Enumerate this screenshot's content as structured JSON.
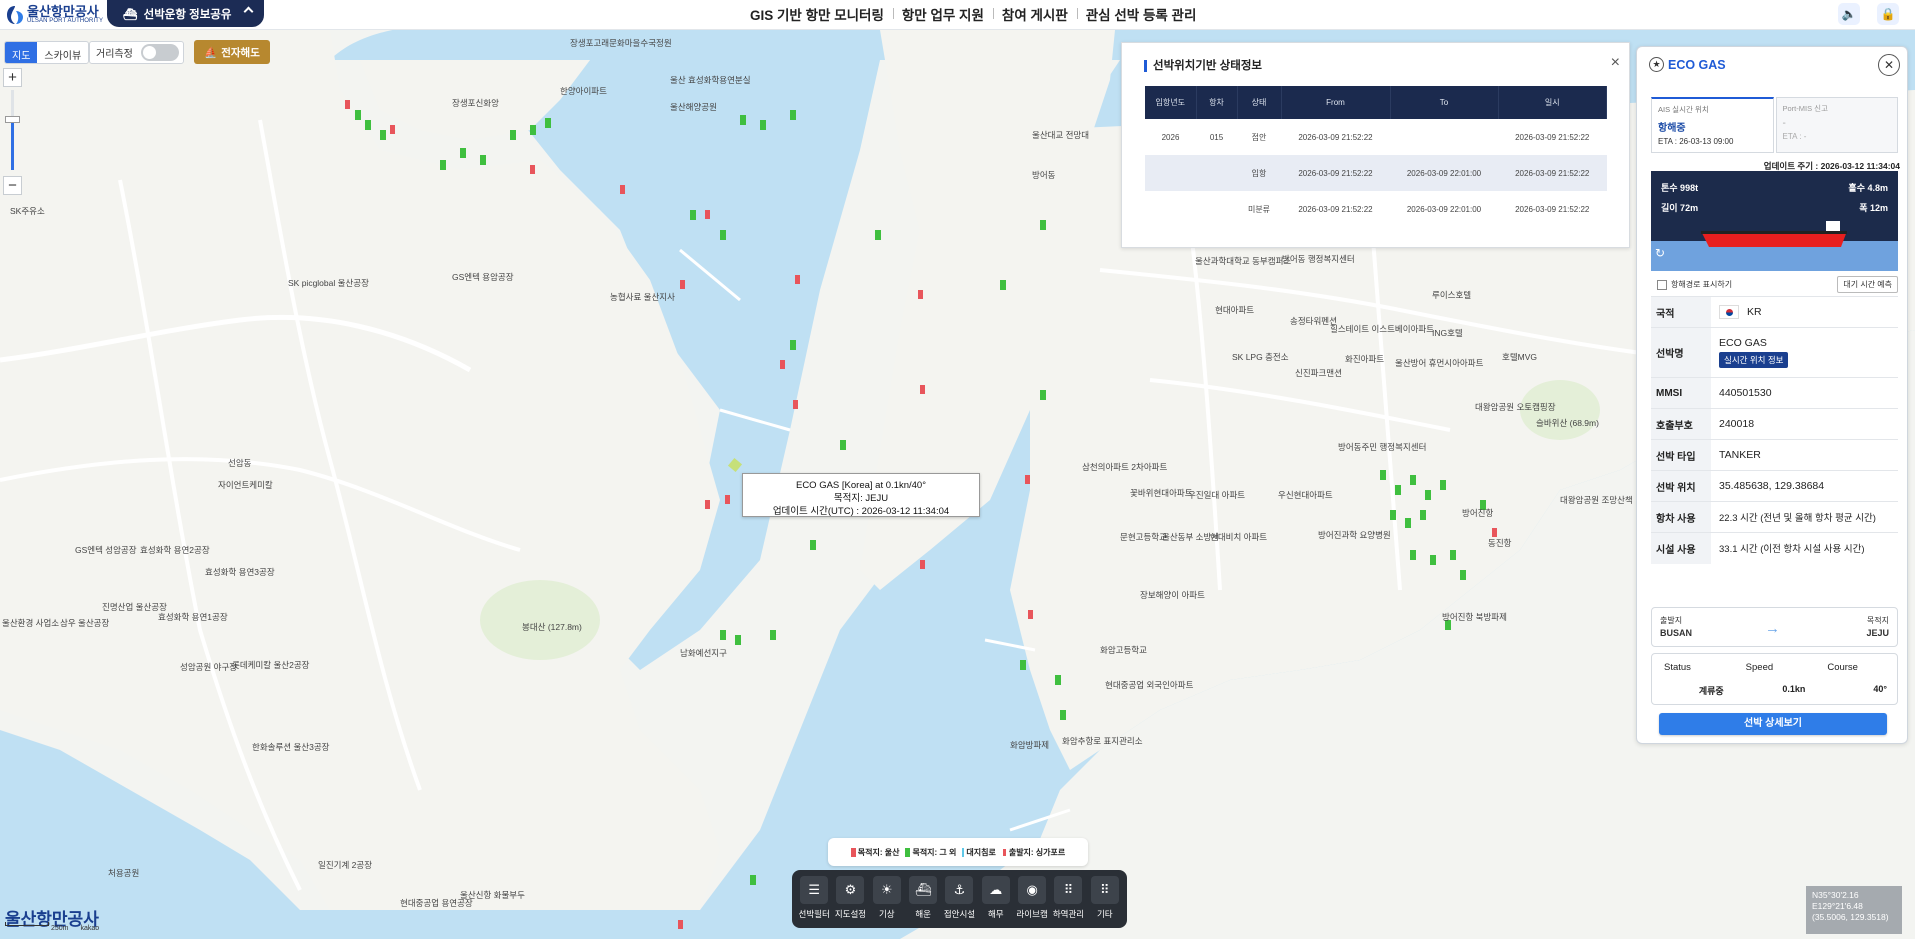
{
  "header": {
    "logo_main": "울산항만공사",
    "logo_sub": "ULSAN PORT AUTHORITY",
    "share_label": "선박운항 정보공유",
    "nav": [
      "GIS 기반 항만 모니터링",
      "항만 업무 지원",
      "참여 게시판",
      "관심 선박 등록 관리"
    ]
  },
  "map_controls": {
    "map_types": [
      "지도",
      "스카이뷰"
    ],
    "distance_label": "거리측정",
    "enc_label": "전자해도",
    "zoom_in": "+",
    "zoom_out": "−"
  },
  "status_popup": {
    "title": "선박위치기반 상태정보",
    "close": "×",
    "columns": [
      "입항년도",
      "항차",
      "상태",
      "From",
      "To",
      "일시"
    ],
    "rows": [
      [
        "2026",
        "015",
        "접안",
        "2026-03-09 21:52:22",
        "",
        "2026-03-09 21:52:22"
      ],
      [
        "",
        "",
        "입항",
        "2026-03-09 21:52:22",
        "2026-03-09 22:01:00",
        "2026-03-09 21:52:22"
      ],
      [
        "",
        "",
        "미분류",
        "2026-03-09 21:52:22",
        "2026-03-09 22:01:00",
        "2026-03-09 21:52:22"
      ]
    ]
  },
  "tooltip": {
    "line1": "ECO GAS [Korea] at 0.1kn/40°",
    "line2": "목적지: JEJU",
    "line3": "업데이트 시간(UTC) : 2026-03-12 11:34:04"
  },
  "legend": [
    "목적지: 울산",
    "목적지: 그 외",
    "대지침로",
    "출발지: 싱가포르"
  ],
  "toolbar": [
    "선박필터",
    "지도설정",
    "기상",
    "해운",
    "접안시설",
    "해무",
    "라이브캠",
    "하역관리",
    "기타"
  ],
  "map_logo": "울산항만공사",
  "scale": {
    "distance": "250m",
    "brand": "kakao"
  },
  "coords": {
    "lat": "N35°30'2.16",
    "lon": "E129°21'6.48",
    "decimal": "(35.5006, 129.3518)"
  },
  "panel": {
    "ship_name": "ECO GAS",
    "tab_ais": {
      "title": "AIS 실시간 위치",
      "value": "항해중",
      "eta": "ETA : 26-03-13 09:00"
    },
    "tab_mis": {
      "title": "Port-MIS 신고",
      "value": "-",
      "eta": "ETA : -"
    },
    "update": "업데이트 주기 : 2026-03-12 11:34:04",
    "ship_tonnage": "톤수 998t",
    "ship_draft": "흘수 4.8m",
    "ship_length": "길이 72m",
    "ship_width": "폭 12m",
    "route_toggle": "항해경로 표시하기",
    "wait_btn": "대기 시간 예측",
    "info": [
      {
        "k": "국적",
        "v": "KR"
      },
      {
        "k": "선박명",
        "v": "ECO GAS",
        "badge": "실시간 위치 정보"
      },
      {
        "k": "MMSI",
        "v": "440501530"
      },
      {
        "k": "호출부호",
        "v": "240018"
      },
      {
        "k": "선박 타입",
        "v": "TANKER"
      },
      {
        "k": "선박 위치",
        "v": "35.485638, 129.38684"
      },
      {
        "k": "항차 사용",
        "v": "22.3 시간 (전년 및 올해 항차 평균 시간)"
      },
      {
        "k": "시설 사용",
        "v": "33.1 시간 (이전 항차 시설 사용 시간)"
      }
    ],
    "route": {
      "from_label": "출발지",
      "from": "BUSAN",
      "to_label": "목적지",
      "to": "JEJU"
    },
    "motion": [
      {
        "h": "Status",
        "v": "계류중"
      },
      {
        "h": "Speed",
        "v": "0.1kn"
      },
      {
        "h": "Course",
        "v": "40°"
      }
    ],
    "detail_btn": "선박 상세보기"
  },
  "map_labels": [
    "장생포고래문화마을수국정원",
    "울산 효성화학용연분실",
    "장생포산업단지",
    "장생포신화앙",
    "한양아이파트",
    "울산해양공원",
    "SK picglobal 울산공장",
    "GS엔텍 용암공장",
    "농협사료 울산지사",
    "SK주유소",
    "선암동",
    "자이언트케미칼",
    "효성화학 용연2공장",
    "효성화학 용연3공장",
    "효성화학 용연1공장",
    "진명산업 울산공장",
    "GS엔텍 성암공장",
    "삼우 울산공장",
    "롯데케미칼 울산2공장",
    "성암공원 야구장",
    "울산성암 야구장",
    "한화솔루션 울산3공장",
    "봉대산 (127.8m)",
    "울산대교 전망대",
    "방어동",
    "울산과학대학교 동부캠퍼스",
    "방어동 행정복지센터",
    "송정타워펜션",
    "힐스테이트 이스트베이아파트",
    "현대아파트",
    "SK LPG 충전소",
    "신진파크맨션",
    "화진아파트",
    "울산방어 휴먼시아아파트",
    "루이스호텔",
    "ING호텔",
    "호텔MVG",
    "대왕암공원 오토캠핑장",
    "슬바위산 (68.9m)",
    "방어진항",
    "대왕암공원 조망산책",
    "방어동주민 행정복지센터",
    "우신현대아파트",
    "삼천의아파트 2차아파트",
    "꽃바위현대아파트",
    "문현고등학교",
    "우진일대 아파트",
    "울산동부 소방서",
    "현대비치 아파트",
    "방어진과학 요양병원",
    "화암한국다이아파트",
    "장보해양이 아파트",
    "화암고등학교",
    "현대중공업 외국인아파트",
    "화암방파제",
    "화암추항로 표지관리소",
    "남화예선지구",
    "울산환경 사업소",
    "처용공원",
    "일진기계 2공장",
    "현대중공업 용연공장",
    "울산신항 화물부두",
    "방어진항 북방파제",
    "동진항"
  ]
}
